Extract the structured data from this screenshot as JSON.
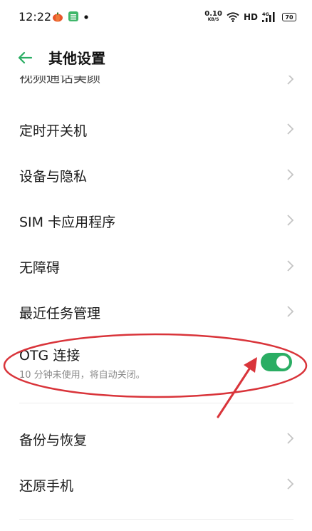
{
  "status_bar": {
    "time": "12:22",
    "net_speed_value": "0.10",
    "net_speed_unit": "KB/S",
    "hd": "HD",
    "signal_label": "4G",
    "battery": "70",
    "icons": [
      "pumpkin-app-icon",
      "green-app-icon",
      "notification-dot-icon",
      "wifi-icon",
      "signal-icon",
      "battery-icon"
    ]
  },
  "header": {
    "title": "其他设置",
    "back_icon": "arrow-left-icon",
    "accent_color": "#2aad63"
  },
  "list": {
    "clipped_item": "视频通话美颜",
    "items": [
      {
        "label": "定时开关机"
      },
      {
        "label": "设备与隐私"
      },
      {
        "label": "SIM 卡应用程序"
      },
      {
        "label": "无障碍"
      },
      {
        "label": "最近任务管理"
      }
    ],
    "otg": {
      "title": "OTG 连接",
      "description": "10 分钟未使用，将自动关闭。",
      "enabled": true
    },
    "items_after": [
      {
        "label": "备份与恢复"
      },
      {
        "label": "还原手机"
      }
    ]
  },
  "annotation": {
    "color": "#d9343a",
    "shapes": [
      "ellipse-highlight",
      "arrow-pointer"
    ]
  }
}
